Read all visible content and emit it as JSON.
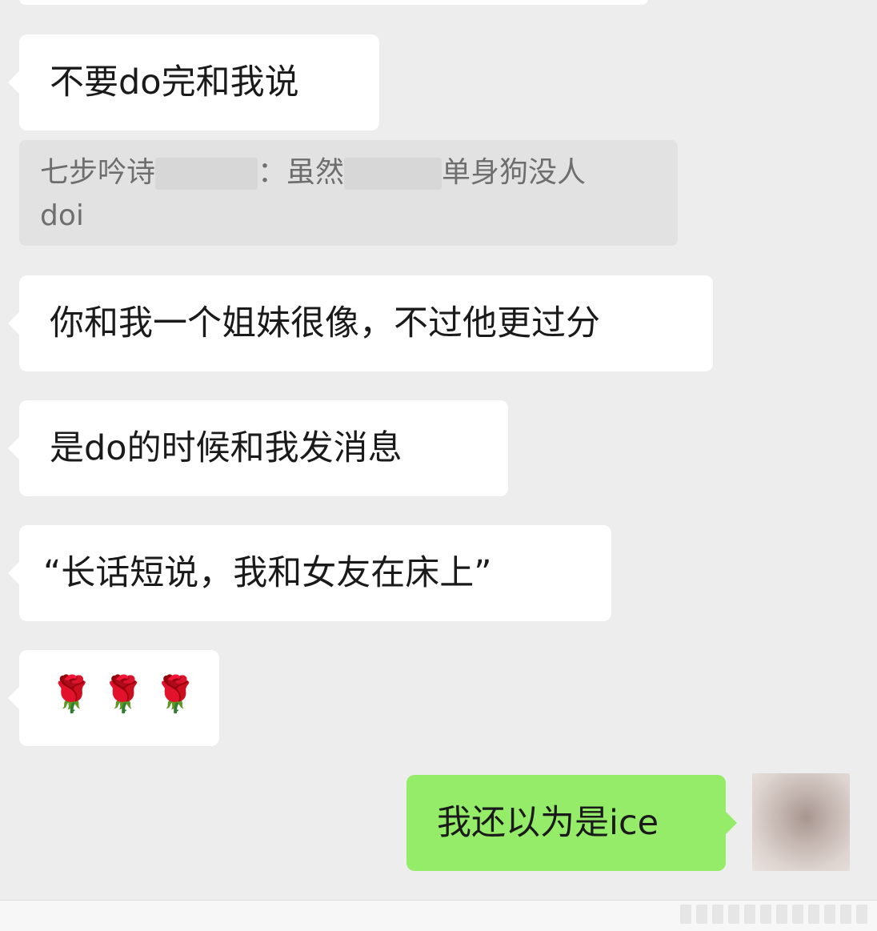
{
  "messages": [
    {
      "side": "left",
      "text": "不要do完和我说"
    },
    {
      "quote": {
        "sender": "七步吟诗",
        "sep": "：",
        "part1": "虽然",
        "part2": "单身狗没人",
        "part3": "doi"
      }
    },
    {
      "side": "left",
      "text": "你和我一个姐妹很像，不过他更过分"
    },
    {
      "side": "left",
      "text": "是do的时候和我发消息"
    },
    {
      "side": "left",
      "text": "“长话短说，我和女友在床上”"
    },
    {
      "side": "left",
      "emoji": "🌹🌹🌹"
    },
    {
      "side": "right",
      "text": "我还以为是ice"
    }
  ],
  "colors": {
    "background": "#ededed",
    "bubble_left": "#ffffff",
    "bubble_right": "#95ec69",
    "quote_bg": "#e2e2e2"
  },
  "icons": [
    "rose-emoji",
    "avatar"
  ]
}
